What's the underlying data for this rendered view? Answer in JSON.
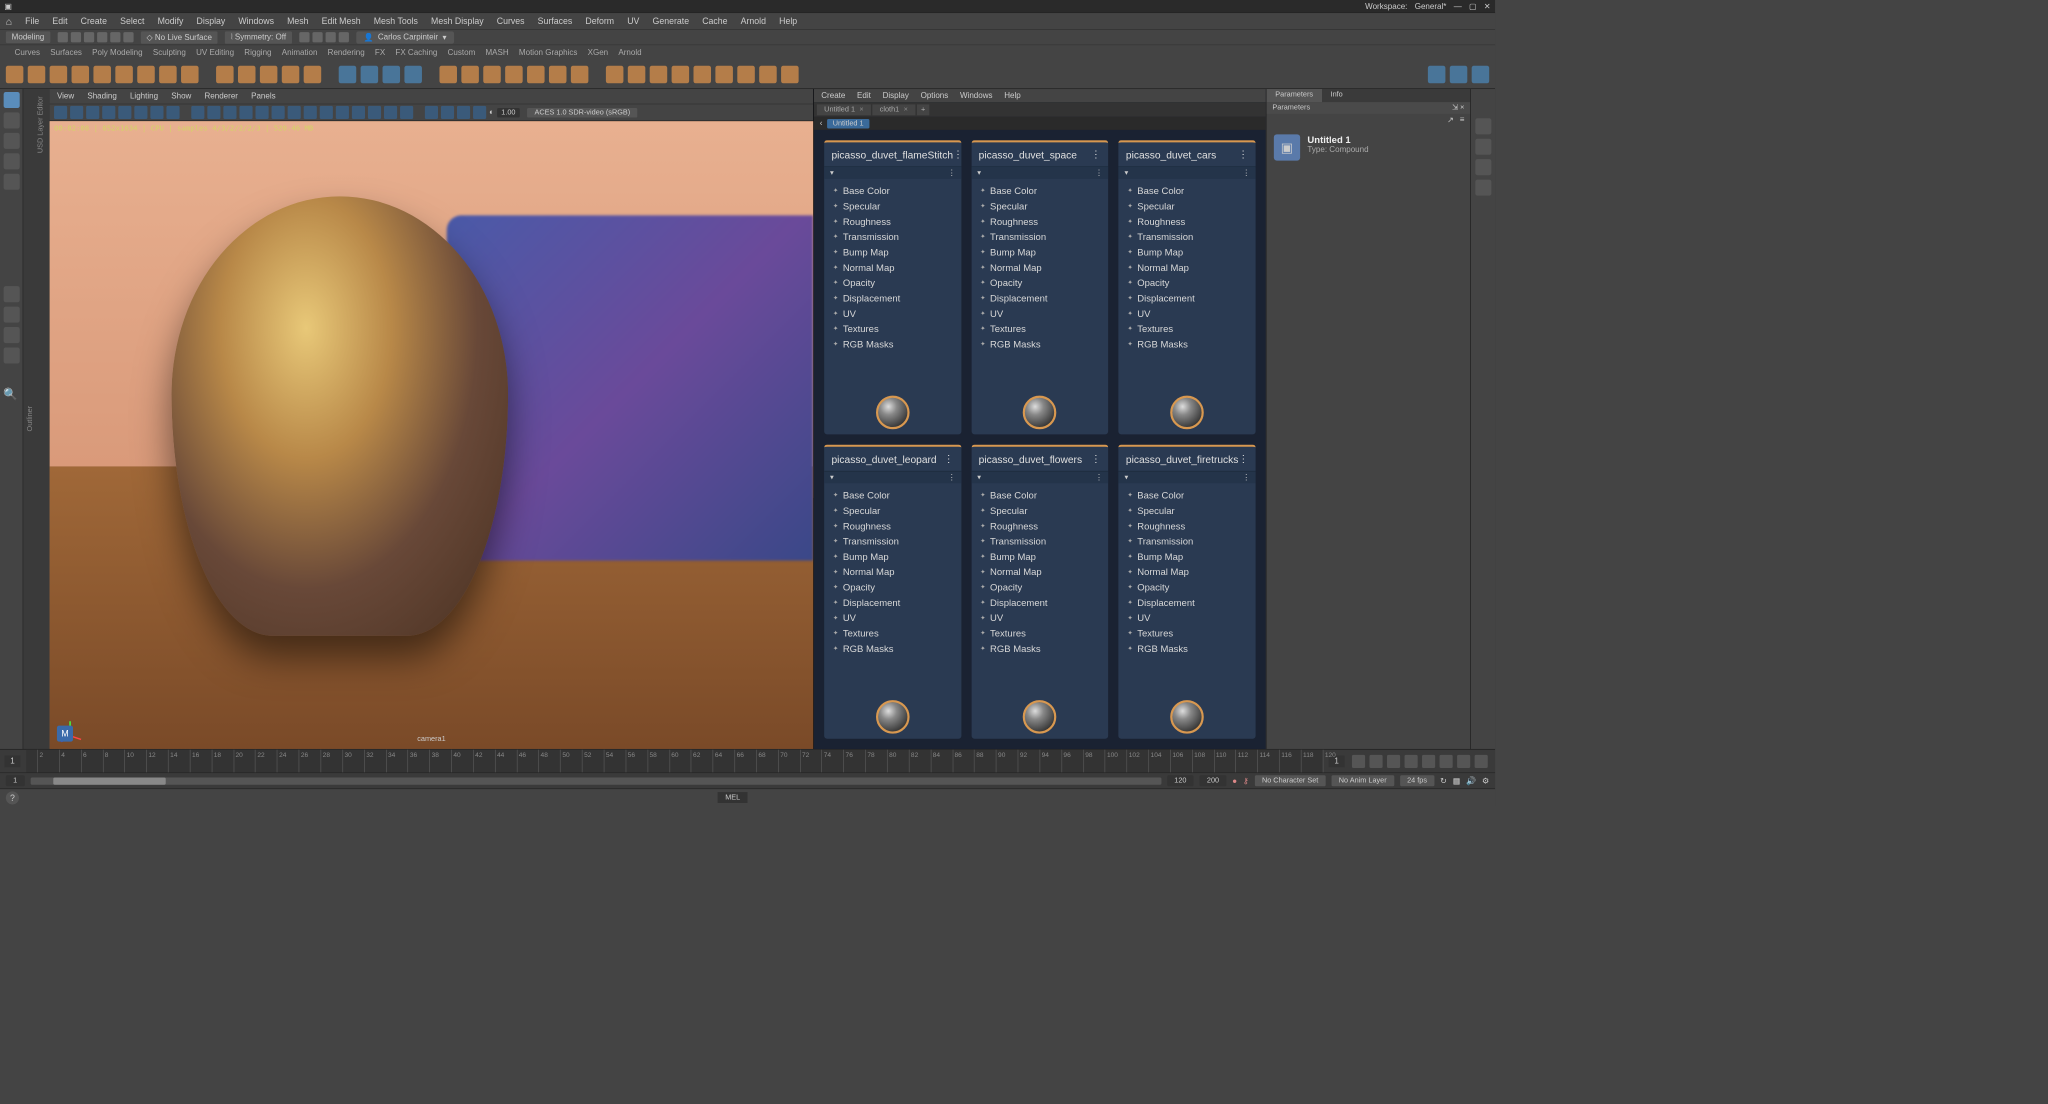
{
  "topbar": {
    "workspace_label": "Workspace:",
    "workspace_value": "General*"
  },
  "menu": [
    "File",
    "Edit",
    "Create",
    "Select",
    "Modify",
    "Display",
    "Windows",
    "Mesh",
    "Edit Mesh",
    "Mesh Tools",
    "Mesh Display",
    "Curves",
    "Surfaces",
    "Deform",
    "UV",
    "Generate",
    "Cache",
    "Arnold",
    "Help"
  ],
  "statusline": {
    "mode": "Modeling",
    "nolive": "No Live Surface",
    "symmetry": "Symmetry: Off",
    "user": "Carlos Carpinteir"
  },
  "shelf_tabs": [
    "Curves",
    "Surfaces",
    "Poly Modeling",
    "Sculpting",
    "UV Editing",
    "Rigging",
    "Animation",
    "Rendering",
    "FX",
    "FX Caching",
    "Custom",
    "MASH",
    "Motion Graphics",
    "XGen",
    "Arnold"
  ],
  "leftpanel_label": "Outliner",
  "vpmenu": [
    "View",
    "Shading",
    "Lighting",
    "Show",
    "Renderer",
    "Panels"
  ],
  "vp_overlay1": "00:02:08 | 852x1634 | CPU | samples 4/3/2/2/2/3 | 520.46 MB",
  "vp_val": "1.00",
  "vp_colorspace": "ACES 1.0 SDR-video (sRGB)",
  "vp_camera": "camera1",
  "nodemenu": [
    "Create",
    "Edit",
    "Display",
    "Options",
    "Windows",
    "Help"
  ],
  "nodetabs": [
    {
      "label": "Untitled 1"
    },
    {
      "label": "cloth1"
    }
  ],
  "breadcrumb": "Untitled 1",
  "node_props": [
    "Base Color",
    "Specular",
    "Roughness",
    "Transmission",
    "Bump Map",
    "Normal Map",
    "Opacity",
    "Displacement",
    "UV",
    "Textures",
    "RGB Masks"
  ],
  "nodes": [
    {
      "title": "picasso_duvet_flameStitch"
    },
    {
      "title": "picasso_duvet_space"
    },
    {
      "title": "picasso_duvet_cars"
    },
    {
      "title": "picasso_duvet_leopard"
    },
    {
      "title": "picasso_duvet_flowers"
    },
    {
      "title": "picasso_duvet_firetrucks"
    }
  ],
  "param_tabs": [
    "Parameters",
    "Info"
  ],
  "param_header": "Parameters",
  "param_title": "Untitled 1",
  "param_type": "Type: Compound",
  "timeline": {
    "start": 1,
    "end": 120,
    "range_end": 200,
    "nochar": "No Character Set",
    "noanim": "No Anim Layer",
    "fps": "24 fps"
  },
  "cmdlabel": "MEL"
}
